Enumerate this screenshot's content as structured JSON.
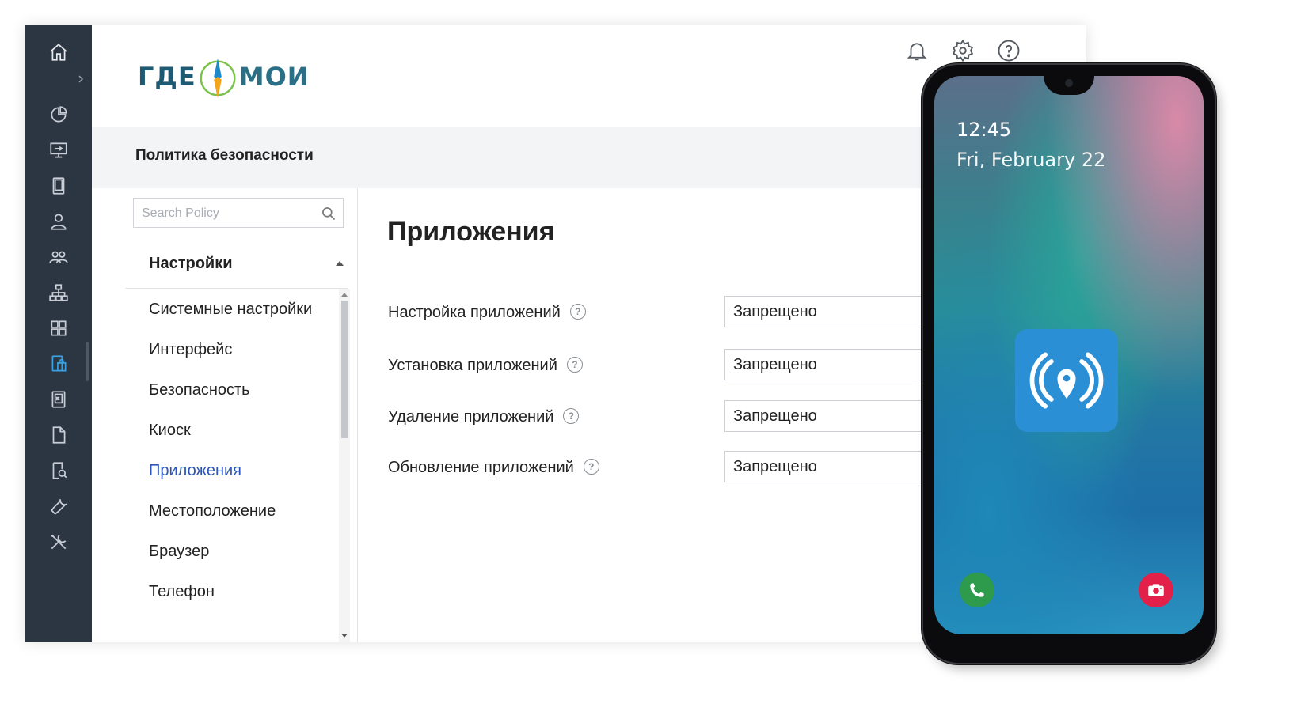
{
  "rail": {
    "icons": [
      "home-icon",
      "chevron-right-icon",
      "pie-chart-icon",
      "monitor-icon",
      "tablet-icon",
      "user-icon",
      "users-icon",
      "org-tree-icon",
      "apps-grid-icon",
      "device-policy-icon",
      "kiosk-icon",
      "document-icon",
      "search-document-icon",
      "wrench-icon",
      "tools-icon"
    ],
    "active_color": "#3aa0e0"
  },
  "header": {
    "logo_left": "ГДЕ",
    "logo_right": "МОИ",
    "icons": [
      "bell-icon",
      "gear-icon",
      "help-icon"
    ]
  },
  "section": {
    "title": "Политика безопасности"
  },
  "policy": {
    "search_placeholder": "Search Policy",
    "group_label": "Настройки",
    "items": [
      {
        "label": "Системные настройки",
        "active": false
      },
      {
        "label": "Интерфейс",
        "active": false
      },
      {
        "label": "Безопасность",
        "active": false
      },
      {
        "label": "Киоск",
        "active": false
      },
      {
        "label": "Приложения",
        "active": true
      },
      {
        "label": "Местоположение",
        "active": false
      },
      {
        "label": "Браузер",
        "active": false
      },
      {
        "label": "Телефон",
        "active": false
      }
    ],
    "active_color": "#2d54b8"
  },
  "content": {
    "title": "Приложения",
    "settings": [
      {
        "label": "Настройка приложений",
        "value": "Запрещено"
      },
      {
        "label": "Установка приложений",
        "value": "Запрещено"
      },
      {
        "label": "Удаление приложений",
        "value": "Запрещено"
      },
      {
        "label": "Обновление приложений",
        "value": "Запрещено"
      }
    ]
  },
  "phone": {
    "time": "12:45",
    "date": "Fri, February 22",
    "app_tile_icon": "location-broadcast-icon",
    "shortcuts": [
      "phone-call-icon",
      "camera-icon"
    ]
  }
}
